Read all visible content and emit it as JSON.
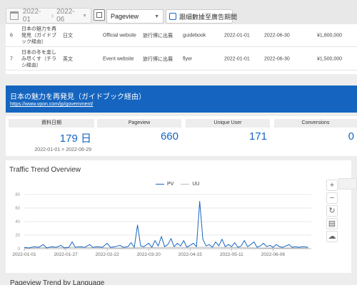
{
  "filters": {
    "date_start": "2022-01",
    "date_end": "2022-06",
    "metric": "Pageview",
    "compare_label": "跟細數據至廣告期間"
  },
  "table": {
    "rows": [
      {
        "index": "6",
        "title": "日本の魅力を再発見（ガイドブック経由）",
        "language": "日文",
        "source": "Official website",
        "category": "旅行博に出展",
        "medium": "guidebook",
        "start": "2022-01-01",
        "end": "2022-06-30",
        "budget": "¥1,800,000"
      },
      {
        "index": "7",
        "title": "日本の冬を楽しみ尽くす（チラシ経由）",
        "language": "英文",
        "source": "Event website",
        "category": "旅行博に出展",
        "medium": "flyer",
        "start": "2022-01-01",
        "end": "2022-06-30",
        "budget": "¥1,500,000"
      }
    ]
  },
  "banner": {
    "title": "日本の魅力を再発見（ガイドブック経由）",
    "link": "https://www.vpon.com/jp/government/"
  },
  "stats": {
    "days": {
      "label": "資料日期",
      "value": "179 日",
      "sub": "2022-01-01 > 2022-06-29"
    },
    "pageview": {
      "label": "Pageview",
      "value": "660"
    },
    "unique_user": {
      "label": "Unique User",
      "value": "171"
    },
    "conversions": {
      "label": "Conversions",
      "value": "0"
    }
  },
  "chart_title": "Traffic Trend Overview",
  "next_section_title": "Pageview Trend by Language",
  "toolbox": [
    "+",
    "−",
    "↻",
    "▤",
    "☁"
  ],
  "colors": {
    "accent": "#1565c0",
    "uu_line": "#bbbbbb"
  },
  "chart_data": {
    "type": "line",
    "title": "Traffic Trend Overview",
    "legend": [
      "PV",
      "UU"
    ],
    "legend_position": "top-center",
    "y_ticks": [
      0,
      20,
      40,
      60,
      80
    ],
    "ylim": [
      0,
      80
    ],
    "x_ticks": [
      "2022-01-01",
      "2022-01-27",
      "2022-02-22",
      "2022-03-20",
      "2022-04-15",
      "2022-05-11",
      "2022-06-06"
    ],
    "x_tick_days": [
      0,
      26,
      52,
      78,
      104,
      130,
      156
    ],
    "days": 180,
    "series": [
      {
        "name": "PV",
        "color": "#1565c0",
        "points": [
          [
            0,
            2
          ],
          [
            3,
            1
          ],
          [
            6,
            3
          ],
          [
            9,
            2
          ],
          [
            12,
            6
          ],
          [
            14,
            1
          ],
          [
            17,
            3
          ],
          [
            20,
            2
          ],
          [
            23,
            5
          ],
          [
            25,
            1
          ],
          [
            28,
            2
          ],
          [
            30,
            10
          ],
          [
            32,
            2
          ],
          [
            35,
            3
          ],
          [
            38,
            2
          ],
          [
            41,
            6
          ],
          [
            43,
            2
          ],
          [
            46,
            3
          ],
          [
            49,
            2
          ],
          [
            52,
            8
          ],
          [
            54,
            2
          ],
          [
            57,
            3
          ],
          [
            60,
            5
          ],
          [
            62,
            2
          ],
          [
            65,
            3
          ],
          [
            67,
            9
          ],
          [
            69,
            2
          ],
          [
            71,
            35
          ],
          [
            73,
            4
          ],
          [
            75,
            3
          ],
          [
            78,
            8
          ],
          [
            80,
            2
          ],
          [
            82,
            12
          ],
          [
            84,
            4
          ],
          [
            86,
            18
          ],
          [
            88,
            3
          ],
          [
            90,
            6
          ],
          [
            92,
            15
          ],
          [
            94,
            3
          ],
          [
            96,
            8
          ],
          [
            98,
            4
          ],
          [
            100,
            12
          ],
          [
            102,
            2
          ],
          [
            104,
            5
          ],
          [
            106,
            8
          ],
          [
            108,
            3
          ],
          [
            110,
            70
          ],
          [
            112,
            14
          ],
          [
            114,
            4
          ],
          [
            116,
            6
          ],
          [
            118,
            2
          ],
          [
            120,
            10
          ],
          [
            122,
            4
          ],
          [
            124,
            14
          ],
          [
            126,
            3
          ],
          [
            128,
            6
          ],
          [
            130,
            3
          ],
          [
            132,
            9
          ],
          [
            134,
            2
          ],
          [
            136,
            4
          ],
          [
            138,
            12
          ],
          [
            140,
            3
          ],
          [
            142,
            6
          ],
          [
            144,
            10
          ],
          [
            146,
            2
          ],
          [
            148,
            4
          ],
          [
            150,
            8
          ],
          [
            152,
            3
          ],
          [
            154,
            5
          ],
          [
            156,
            2
          ],
          [
            158,
            6
          ],
          [
            160,
            3
          ],
          [
            162,
            2
          ],
          [
            164,
            4
          ],
          [
            166,
            6
          ],
          [
            168,
            2
          ],
          [
            170,
            3
          ],
          [
            172,
            2
          ],
          [
            175,
            3
          ],
          [
            178,
            2
          ]
        ]
      },
      {
        "name": "UU",
        "color": "#bbbbbb",
        "points": [
          [
            0,
            1
          ],
          [
            30,
            2
          ],
          [
            60,
            1
          ],
          [
            90,
            2
          ],
          [
            120,
            2
          ],
          [
            150,
            1
          ],
          [
            178,
            1
          ]
        ]
      }
    ]
  }
}
